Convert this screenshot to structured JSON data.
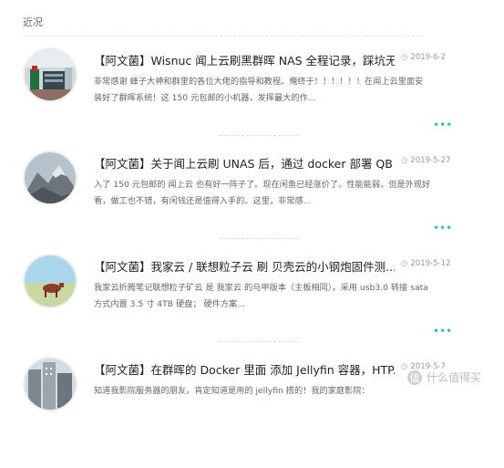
{
  "section": {
    "title": "近况"
  },
  "posts": [
    {
      "title": "【阿文菌】Wisnuc 闻上云刷黑群晖 NAS 全程记录，踩坑无...",
      "date": "2019-6-2",
      "excerpt": "非常感谢 蜂子大神和群里的各位大佬的指导和教程。俺终于！！！！！！在闻上云里面安装好了群晖系统！这 150 元包邮的小机器，发挥最大的作...",
      "more": "•••",
      "icon": "clock-icon"
    },
    {
      "title": "【阿文菌】关于闻上云刷 UNAS 后，通过 docker 部署 QB ...",
      "date": "2019-5-27",
      "excerpt": "入了 150 元包邮的 闻上云 也有好一阵子了。现在闲鱼已经涨价了。性能能弱，但是外观好看，做工也不错，有闲钱还是值得入手的。这里，非常感...",
      "more": "•••",
      "icon": "clock-icon"
    },
    {
      "title": "【阿文菌】我家云 / 联想粒子云 刷 贝壳云的小钢炮固件测...",
      "date": "2019-5-12",
      "excerpt": "我家云折腾笔记联想粒子矿云 是 我家云 的马甲版本（主板相同），采用 usb3.0 转接 sata 方式内置 3.5 寸 4TB 硬盘； 硬件方案...",
      "more": "•••",
      "icon": "clock-icon"
    },
    {
      "title": "【阿文菌】在群晖的 Docker 里面 添加 Jellyfin 容器，HTP...",
      "date": "2019-5-7",
      "excerpt": "知道我影院服务器的朋友，肯定知道是用的 jellyfin 搭的！我的家庭影院：",
      "more": "•••",
      "icon": "clock-icon"
    }
  ],
  "watermark": {
    "badge": "值",
    "text": "什么值得买"
  },
  "colors": {
    "accent": "#3fc1a4",
    "date": "#999999",
    "text": "#666666"
  }
}
